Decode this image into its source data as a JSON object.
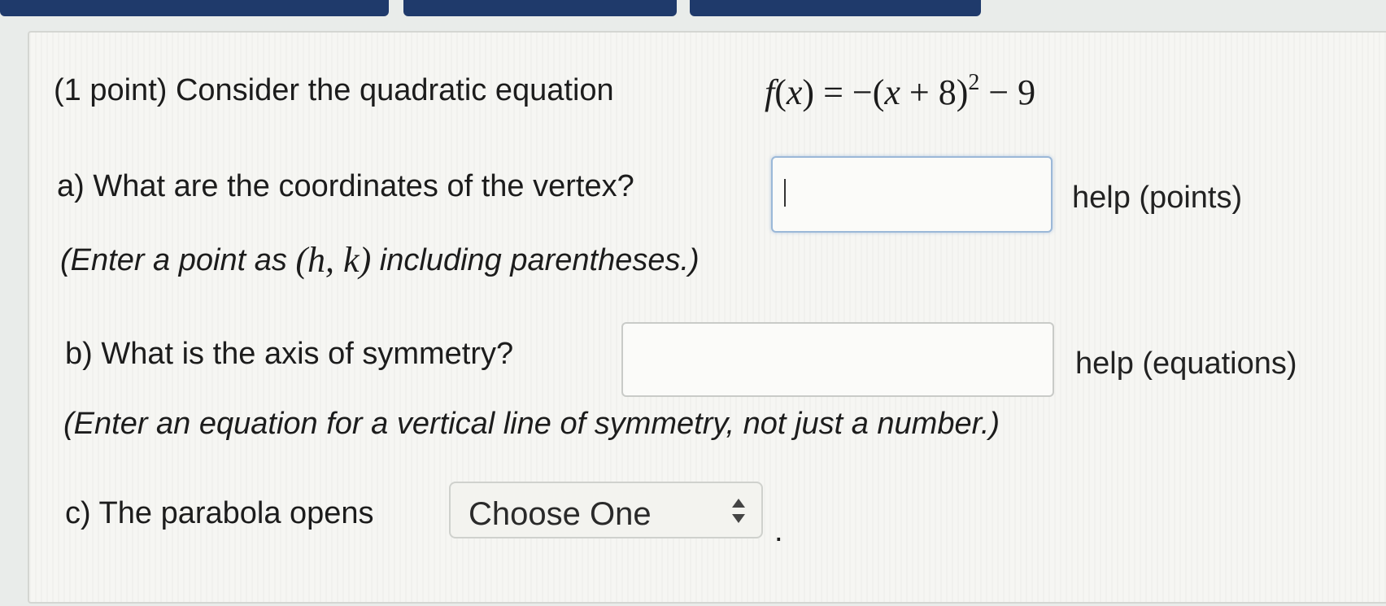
{
  "q_intro": "(1 point) Consider the quadratic equation",
  "equation": {
    "f": "f",
    "x": "x",
    "eq": ") = −(",
    "plus": " + 8)",
    "exp": "2",
    "minus": " − 9"
  },
  "part_a": {
    "question": "a) What are the coordinates of the vertex?",
    "input_value": "",
    "help": "help (points)",
    "note_before": "(Enter a point as",
    "note_math_h": "h",
    "note_math_k": "k",
    "note_after": "including parentheses.)"
  },
  "part_b": {
    "question": "b) What is the axis of symmetry?",
    "input_value": "",
    "help": "help (equations)",
    "note": "(Enter an equation for a vertical line of symmetry, not just a number.)"
  },
  "part_c": {
    "question": "c) The parabola opens",
    "select_value": "Choose One",
    "period": "."
  }
}
